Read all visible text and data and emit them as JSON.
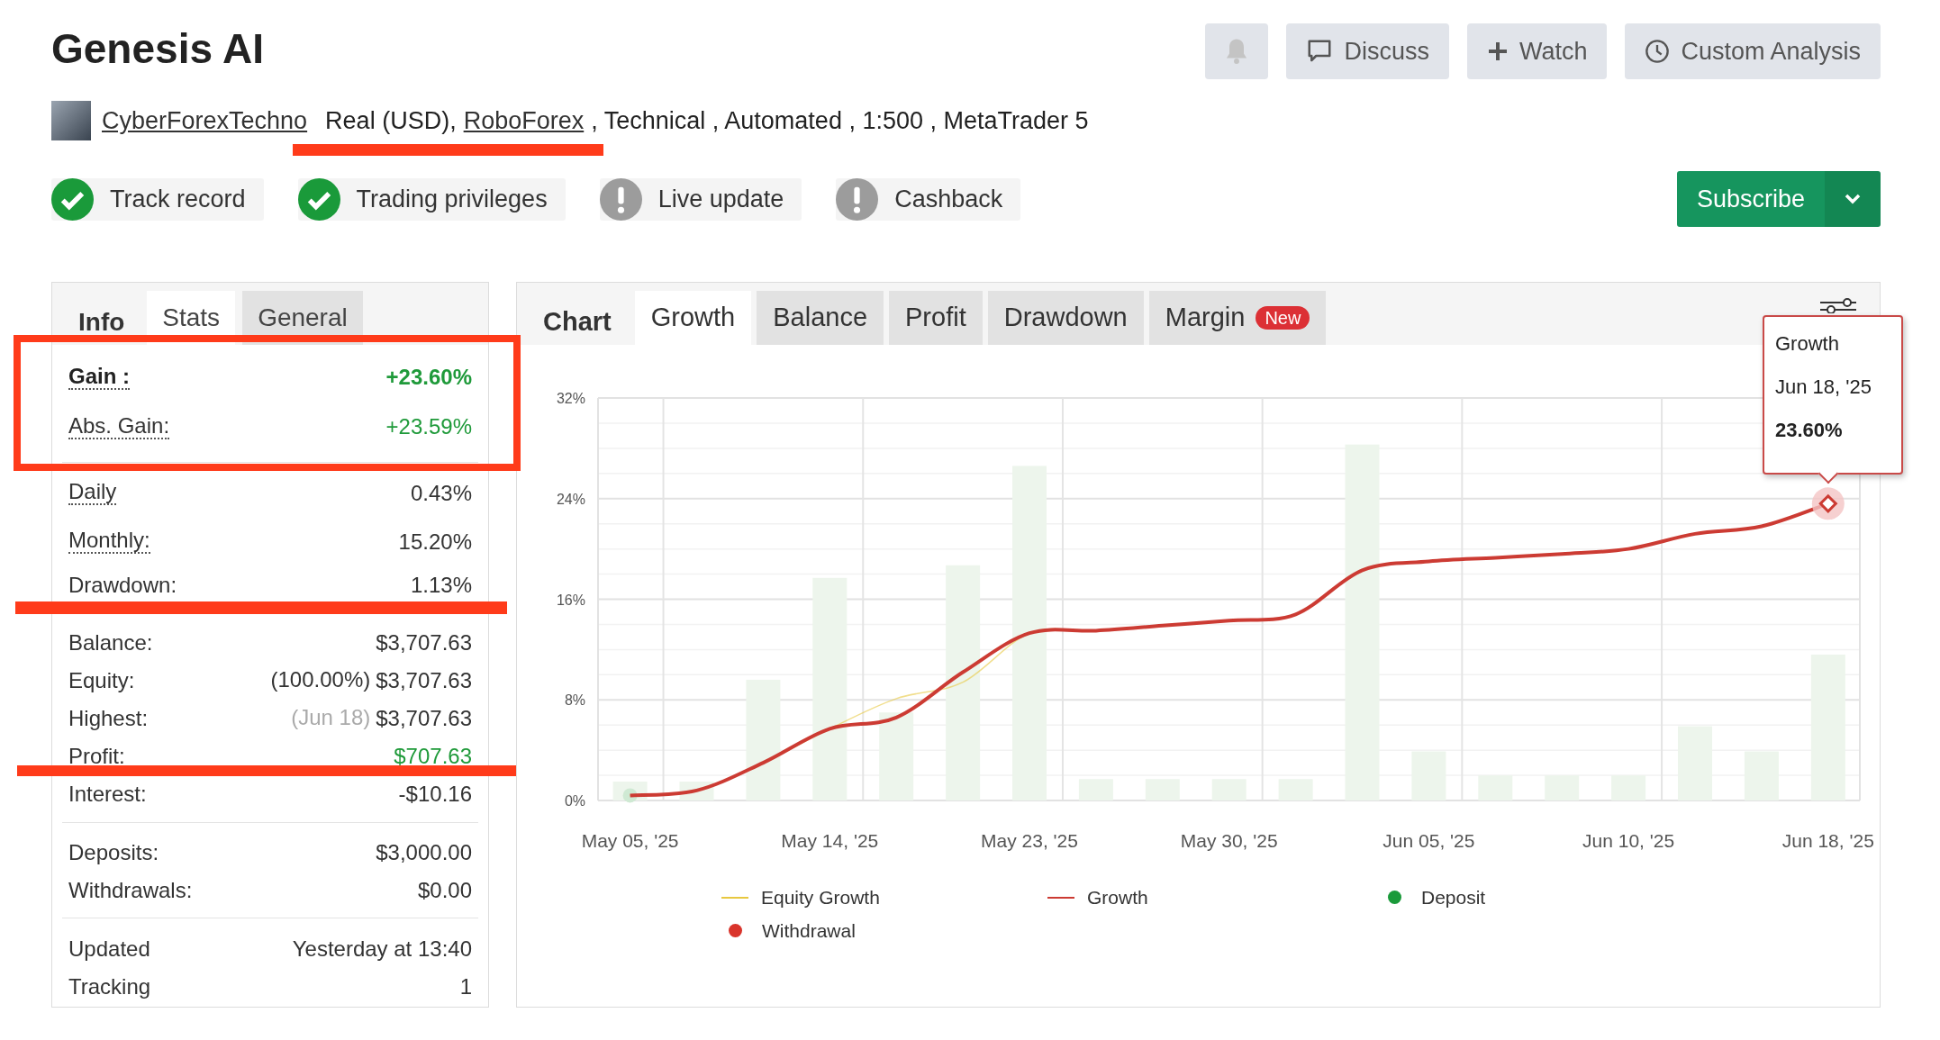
{
  "header": {
    "title": "Genesis AI",
    "actions": [
      {
        "kind": "bell",
        "disabled": true
      },
      {
        "kind": "discuss",
        "label": "Discuss",
        "disabled": false
      },
      {
        "kind": "watch",
        "label": "Watch",
        "disabled": false
      },
      {
        "kind": "analysis",
        "label": "Custom Analysis",
        "disabled": false
      }
    ]
  },
  "account": {
    "author": "CyberForexTechno",
    "parts": [
      {
        "kind": "text",
        "text": "Real (USD),"
      },
      {
        "kind": "link",
        "text": "RoboForex"
      },
      {
        "kind": "text",
        "text": ", Technical , Automated , 1:500 , MetaTrader 5"
      }
    ]
  },
  "checks": [
    {
      "label": "Track record",
      "verified": true
    },
    {
      "label": "Trading privileges",
      "verified": true
    },
    {
      "label": "Live update",
      "verified": false
    },
    {
      "label": "Cashback",
      "verified": false
    }
  ],
  "subscribe": {
    "label": "Subscribe"
  },
  "info_panel": {
    "heading": "Info",
    "tabs": [
      {
        "label": "Stats",
        "selected": true
      },
      {
        "label": "General",
        "selected": false
      }
    ],
    "groups": [
      {
        "divider": false,
        "rows": [
          {
            "label": "Gain :",
            "value": "+23.60%",
            "positive": true,
            "strong": true,
            "hint": true
          },
          {
            "label": "Abs. Gain:",
            "value": "+23.59%",
            "positive": true,
            "strong": false,
            "hint": true
          }
        ]
      },
      {
        "divider": true,
        "rows": [
          {
            "label": "Daily",
            "value": "0.43%",
            "positive": false,
            "strong": false,
            "hint": true
          },
          {
            "label": "Monthly:",
            "value": "15.20%",
            "positive": false,
            "strong": false,
            "hint": true
          },
          {
            "label": "Drawdown:",
            "value": "1.13%",
            "positive": false,
            "strong": false,
            "hint": false
          }
        ]
      },
      {
        "divider": false,
        "rows": [
          {
            "label": "Balance:",
            "value": "$3,707.63",
            "positive": false,
            "strong": false,
            "hint": false
          },
          {
            "label": "Equity:",
            "note": {
              "text": "(100.00%)",
              "muted": false
            },
            "value": "$3,707.63",
            "positive": false,
            "strong": false,
            "hint": false
          },
          {
            "label": "Highest:",
            "note": {
              "text": "(Jun 18)",
              "muted": true
            },
            "value": "$3,707.63",
            "positive": false,
            "strong": false,
            "hint": false
          },
          {
            "label": "Profit:",
            "value": "$707.63",
            "positive": true,
            "strong": false,
            "hint": false
          },
          {
            "label": "Interest:",
            "value": "-$10.16",
            "positive": false,
            "strong": false,
            "hint": false
          }
        ]
      },
      {
        "divider": true,
        "rows": [
          {
            "label": "Deposits:",
            "value": "$3,000.00",
            "positive": false,
            "strong": false,
            "hint": false
          },
          {
            "label": "Withdrawals:",
            "value": "$0.00",
            "positive": false,
            "strong": false,
            "hint": false
          }
        ]
      },
      {
        "divider": true,
        "rows": [
          {
            "label": "Updated",
            "value": "Yesterday at 13:40",
            "positive": false,
            "strong": false,
            "hint": false
          },
          {
            "label": "Tracking",
            "value": "1",
            "positive": false,
            "strong": false,
            "hint": false
          }
        ]
      }
    ]
  },
  "chart_panel": {
    "heading": "Chart",
    "tabs": [
      {
        "label": "Growth",
        "selected": true
      },
      {
        "label": "Balance",
        "selected": false
      },
      {
        "label": "Profit",
        "selected": false
      },
      {
        "label": "Drawdown",
        "selected": false
      },
      {
        "label": "Margin",
        "badge": "New",
        "selected": false
      }
    ],
    "chart_data": {
      "type": "line",
      "grid": true,
      "categories": [
        "May 05, '25",
        null,
        null,
        "May 14, '25",
        null,
        null,
        "May 23, '25",
        null,
        null,
        "May 30, '25",
        null,
        null,
        "Jun 05, '25",
        null,
        null,
        "Jun 10, '25",
        null,
        null,
        "Jun 18, '25"
      ],
      "ylim": [
        0,
        32
      ],
      "yticks": [
        {
          "value": 0,
          "label": "0%"
        },
        {
          "value": 8,
          "label": "8%"
        },
        {
          "value": 16,
          "label": "16%"
        },
        {
          "value": 24,
          "label": "24%"
        },
        {
          "value": 32,
          "label": "32%"
        }
      ],
      "series": [
        {
          "type": "bar",
          "color": "#edf5ec",
          "values": [
            1.5,
            1.5,
            9.6,
            17.7,
            7.0,
            18.7,
            26.6,
            1.7,
            1.7,
            1.7,
            1.7,
            28.3,
            3.9,
            2.0,
            2.0,
            2.0,
            5.9,
            3.9,
            11.6
          ]
        },
        {
          "type": "line",
          "name": "Equity Growth",
          "color": "#e8c840",
          "values": [
            0.4,
            0.8,
            3.0,
            5.7,
            8.1,
            9.4,
            13.3,
            13.5,
            13.9,
            14.3,
            14.8,
            18.3,
            19.0,
            19.3,
            19.6,
            20.0,
            21.2,
            21.8,
            23.6
          ]
        },
        {
          "type": "line",
          "name": "Growth",
          "color": "#cc3b33",
          "values": [
            0.4,
            0.8,
            3.0,
            5.7,
            6.6,
            10.2,
            13.3,
            13.5,
            13.9,
            14.3,
            14.8,
            18.3,
            19.0,
            19.3,
            19.6,
            20.0,
            21.2,
            21.8,
            23.6
          ]
        }
      ]
    },
    "legend": [
      {
        "label": "Deposit",
        "kind": "dot",
        "color": "#1a9a3a"
      },
      {
        "label": "Withdrawal",
        "kind": "dot",
        "color": "#d9342b"
      }
    ],
    "tooltip": {
      "title": "Growth",
      "date": "Jun 18, '25",
      "value": "23.60%"
    }
  }
}
